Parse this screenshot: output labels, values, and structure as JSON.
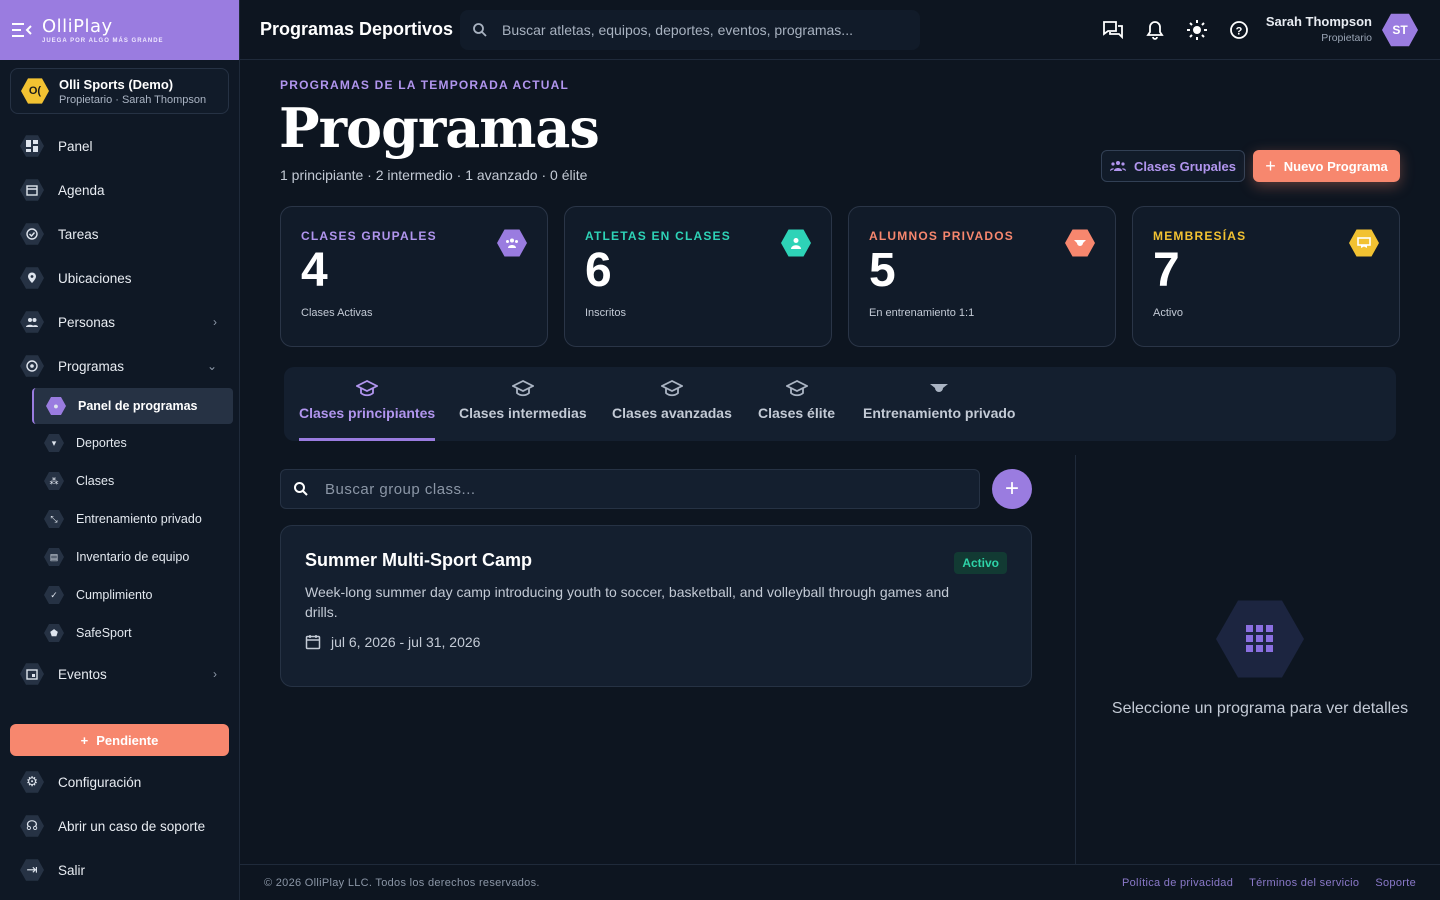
{
  "brand": {
    "logo": "OlliPlay",
    "tagline": "JUEGA POR ALGO MÁS GRANDE"
  },
  "org": {
    "initials": "O(",
    "name": "Olli Sports (Demo)",
    "subtitle": "Propietario · Sarah Thompson"
  },
  "sidebar": {
    "items": [
      {
        "label": "Panel",
        "icon": "dashboard-icon"
      },
      {
        "label": "Agenda",
        "icon": "calendar-icon"
      },
      {
        "label": "Tareas",
        "icon": "check-circle-icon"
      },
      {
        "label": "Ubicaciones",
        "icon": "map-pin-icon"
      },
      {
        "label": "Personas",
        "icon": "people-icon"
      },
      {
        "label": "Programas",
        "icon": "soccer-ball-icon"
      }
    ],
    "sub_items": [
      {
        "label": "Panel de programas"
      },
      {
        "label": "Deportes"
      },
      {
        "label": "Clases"
      },
      {
        "label": "Entrenamiento privado"
      },
      {
        "label": "Inventario de equipo"
      },
      {
        "label": "Cumplimiento"
      },
      {
        "label": "SafeSport"
      }
    ],
    "events": {
      "label": "Eventos"
    },
    "pending_button": "Pendiente",
    "bottom": [
      {
        "label": "Configuración"
      },
      {
        "label": "Abrir un caso de soporte"
      },
      {
        "label": "Salir"
      }
    ]
  },
  "topbar": {
    "title": "Programas Deportivos",
    "search_placeholder": "Buscar atletas, equipos, deportes, eventos, programas...",
    "user_name": "Sarah Thompson",
    "user_role": "Propietario",
    "avatar": "ST"
  },
  "main": {
    "eyebrow": "PROGRAMAS DE LA TEMPORADA ACTUAL",
    "title": "Programas",
    "summary": "1 principiante · 2 intermedio · 1 avanzado · 0 élite",
    "group_classes_button": "Clases Grupales",
    "new_program_button": "Nuevo Programa"
  },
  "stats": [
    {
      "label": "CLASES GRUPALES",
      "value": "4",
      "sub": "Clases Activas",
      "color": "#9a7ce0"
    },
    {
      "label": "ATLETAS EN CLASES",
      "value": "6",
      "sub": "Inscritos",
      "color": "#2ed3b7"
    },
    {
      "label": "ALUMNOS PRIVADOS",
      "value": "5",
      "sub": "En entrenamiento 1:1",
      "color": "#f7876e"
    },
    {
      "label": "MEMBRESÍAS",
      "value": "7",
      "sub": "Activo",
      "color": "#f2c232"
    }
  ],
  "tabs": [
    {
      "label": "Clases principiantes"
    },
    {
      "label": "Clases intermedias"
    },
    {
      "label": "Clases avanzadas"
    },
    {
      "label": "Clases élite"
    },
    {
      "label": "Entrenamiento privado"
    }
  ],
  "class_search_placeholder": "Buscar group class...",
  "program_card": {
    "title": "Summer Multi-Sport Camp",
    "status": "Activo",
    "description": "Week-long summer day camp introducing youth to soccer, basketball, and volleyball through games and drills.",
    "dates": "jul 6, 2026 - jul 31, 2026"
  },
  "detail_empty": "Seleccione un programa para ver detalles",
  "footer": {
    "copyright": "© 2026 OlliPlay LLC. Todos los derechos reservados.",
    "privacy": "Política de privacidad",
    "terms": "Términos del servicio",
    "support": "Soporte"
  }
}
